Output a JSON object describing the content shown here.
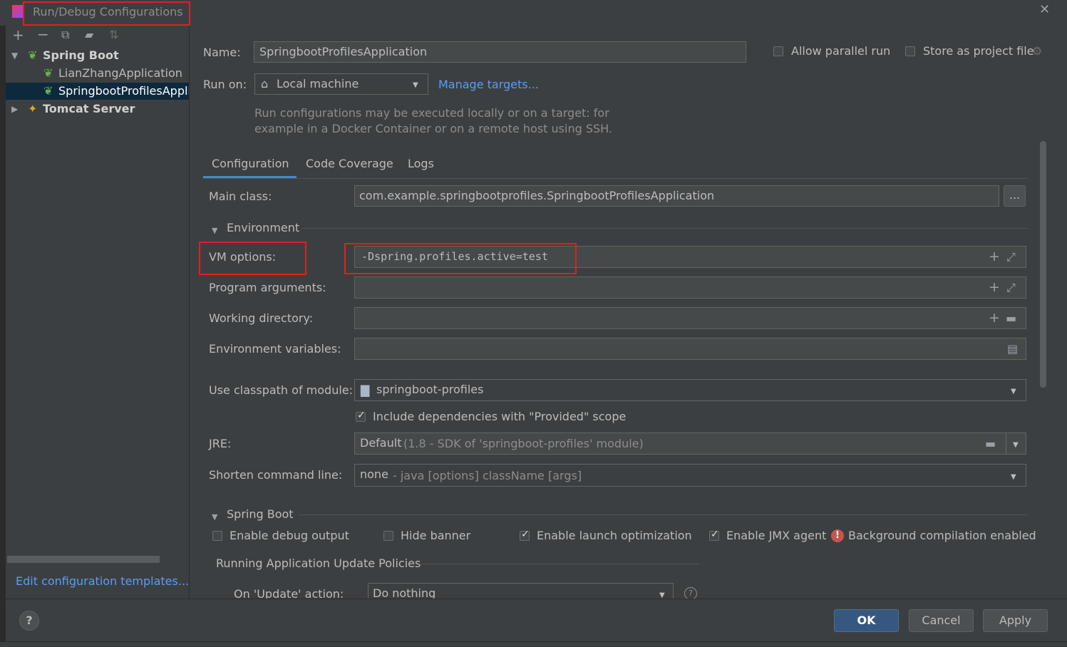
{
  "window": {
    "title": "Run/Debug Configurations",
    "close_icon": "close-icon"
  },
  "toolbar": {
    "icons": [
      "add-icon",
      "remove-icon",
      "copy-icon",
      "folder-add-icon",
      "sort-icon"
    ]
  },
  "tree": {
    "spring_boot": "Spring Boot",
    "lianzhang": "LianZhangApplication",
    "springboot_profiles": "SpringbootProfilesApplic",
    "tomcat": "Tomcat Server"
  },
  "left_footer": {
    "edit_templates": "Edit configuration templates..."
  },
  "header": {
    "name_label": "Name:",
    "name_value": "SpringbootProfilesApplication",
    "allow_parallel": "Allow parallel run",
    "store_as_project": "Store as project file",
    "run_on_label": "Run on:",
    "run_on_value": "Local machine",
    "manage_targets": "Manage targets...",
    "hint_line1": "Run configurations may be executed locally or on a target: for",
    "hint_line2": "example in a Docker Container or on a remote host using SSH."
  },
  "tabs": [
    "Configuration",
    "Code Coverage",
    "Logs"
  ],
  "config": {
    "main_class_label": "Main class:",
    "main_class_value": "com.example.springbootprofiles.SpringbootProfilesApplication",
    "browse_label": "...",
    "environment": "Environment",
    "vm_options_label": "VM options:",
    "vm_options_value": "-Dspring.profiles.active=test",
    "program_args_label": "Program arguments:",
    "working_dir_label": "Working directory:",
    "env_vars_label": "Environment variables:",
    "classpath_label": "Use classpath of module:",
    "classpath_value": "springboot-profiles",
    "include_deps": "Include dependencies with \"Provided\" scope",
    "jre_label": "JRE:",
    "jre_value": "Default",
    "jre_hint": "(1.8 - SDK of 'springboot-profiles' module)",
    "shorten_label": "Shorten command line:",
    "shorten_value": "none",
    "shorten_hint": "- java [options] className [args]"
  },
  "spring_boot": {
    "section": "Spring Boot",
    "debug_output": "Enable debug output",
    "hide_banner": "Hide banner",
    "launch_opt": "Enable launch optimization",
    "jmx_agent": "Enable JMX agent",
    "background_compilation": "Background compilation enabled",
    "update_policies": "Running Application Update Policies",
    "on_update_label": "On 'Update' action:",
    "on_update_value": "Do nothing"
  },
  "footer": {
    "ok": "OK",
    "cancel": "Cancel",
    "apply": "Apply",
    "help": "?"
  },
  "colors": {
    "accent": "#589df6",
    "highlight": "#e02020",
    "selection": "#0d293e",
    "primary": "#365880"
  }
}
